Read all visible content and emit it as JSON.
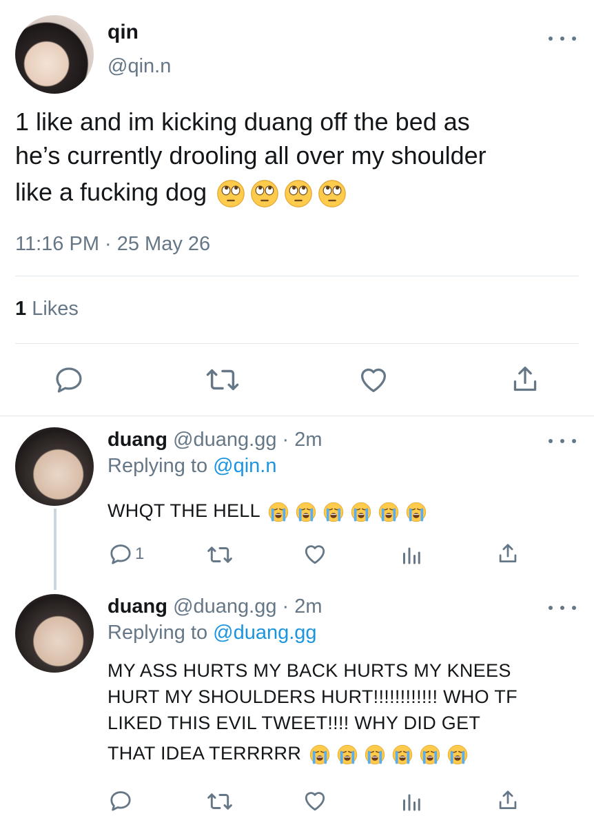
{
  "tweet": {
    "display_name": "qin",
    "handle": "@qin.n",
    "text_lines": [
      "1 like and im kicking duang off the bed as",
      "he’s currently drooling all over my shoulder",
      "like a fucking dog"
    ],
    "emoji_count": 4,
    "emoji_name": "face-with-rolling-eyes",
    "timestamp": "11:16 PM · 25 May 26",
    "likes_count": "1",
    "likes_label": "Likes"
  },
  "replies": [
    {
      "display_name": "duang",
      "handle": "@duang.gg",
      "time": "· 2m",
      "replying_prefix": "Replying to",
      "replying_to": "@qin.n",
      "text_lines": [
        "WHQT THE HELL"
      ],
      "emoji_count": 6,
      "emoji_name": "loudly-crying-face",
      "reply_count": "1"
    },
    {
      "display_name": "duang",
      "handle": "@duang.gg",
      "time": "· 2m",
      "replying_prefix": "Replying to",
      "replying_to": "@duang.gg",
      "text_lines": [
        "MY ASS HURTS MY BACK HURTS MY KNEES",
        "HURT MY SHOULDERS HURT!!!!!!!!!!!! WHO TF",
        "LIKED THIS EVIL TWEET!!!! WHY DID GET",
        "THAT IDEA TERRRRR"
      ],
      "emoji_count": 6,
      "emoji_name": "loudly-crying-face",
      "reply_count": ""
    }
  ],
  "colors": {
    "text": "#14171a",
    "secondary": "#657786",
    "link": "#1b95e0",
    "divider": "#e1e8ed"
  }
}
